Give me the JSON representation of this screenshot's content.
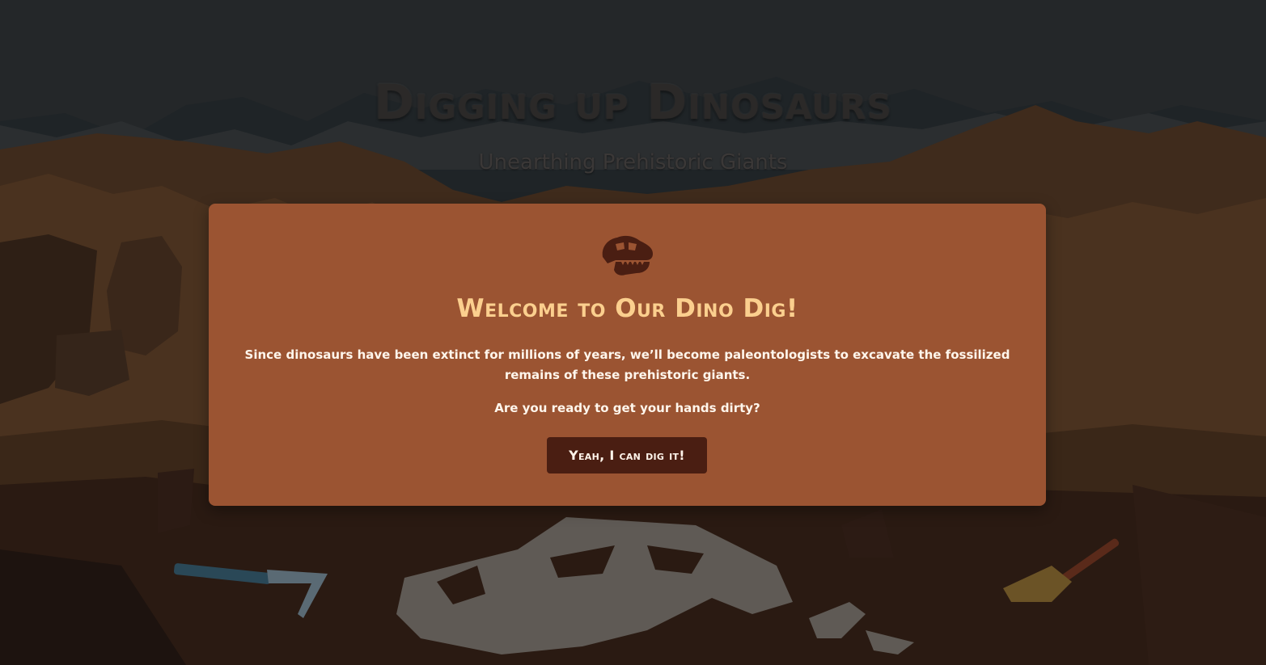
{
  "hero": {
    "title": "Digging up Dinosaurs",
    "subtitle": "Unearthing Prehistoric Giants"
  },
  "modal": {
    "icon": "dinosaur-skull-icon",
    "heading": "Welcome to Our Dino Dig!",
    "body": "Since dinosaurs have been extinct for millions of years, we’ll become paleontologists to excavate the fossilized remains of these prehistoric giants.",
    "question": "Are you ready to get your hands dirty?",
    "button_label": "Yeah, I can dig it!"
  },
  "colors": {
    "modal_background": "#9b5432",
    "heading": "#fbcf8e",
    "button_background": "#4a1e12",
    "button_text": "#fff4ea"
  }
}
